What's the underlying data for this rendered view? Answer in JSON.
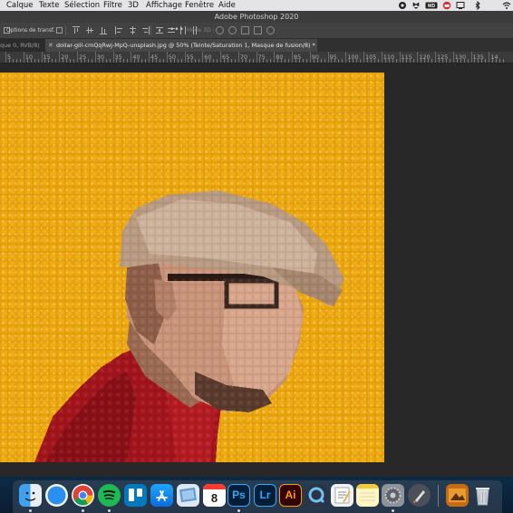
{
  "menubar": {
    "items": [
      "Calque",
      "Texte",
      "Sélection",
      "Filtre",
      "3D",
      "Affichage",
      "Fenêtre",
      "Aide"
    ],
    "status_icons": [
      "record-icon",
      "dropbox-icon",
      "wd-icon",
      "creative-cloud-icon",
      "display-icon",
      "bluetooth-icon",
      "wifi-icon"
    ]
  },
  "titlebar": {
    "title": "Adobe Photoshop 2020"
  },
  "options": {
    "show_transform_label": "Options de transf.",
    "more_label": "•••",
    "mode3d_label": "Mode 3D :"
  },
  "tabs": [
    {
      "label": "que 0, RVB/8)",
      "active": false
    },
    {
      "label": "dollar-gill-cmQqRwj-MpQ-unsplash.jpg @ 50% (Teinte/Saturation 1, Masque de fusion/8) *",
      "active": true
    }
  ],
  "ruler": {
    "labels": [
      "5",
      "10",
      "15",
      "20",
      "25",
      "30",
      "35",
      "40",
      "45",
      "50",
      "55",
      "60",
      "65",
      "70",
      "75",
      "80",
      "85",
      "90",
      "95",
      "100",
      "105",
      "110",
      "115",
      "120",
      "125",
      "130",
      "135",
      "14"
    ]
  },
  "colors": {
    "canvas_bg": "#f1a90a",
    "workspace_bg": "#282828",
    "ps_blue": "#31a8ff",
    "ai_orange": "#ff9a00"
  },
  "canvas": {
    "content": "pixelated-lego-portrait"
  },
  "dock": {
    "apps": [
      {
        "name": "Finder",
        "icon": "finder-icon",
        "text": ""
      },
      {
        "name": "Safari",
        "icon": "safari-icon",
        "text": ""
      },
      {
        "name": "Chrome",
        "icon": "chrome-icon",
        "text": ""
      },
      {
        "name": "Spotify",
        "icon": "spotify-icon",
        "text": ""
      },
      {
        "name": "Trello",
        "icon": "trello-icon",
        "text": ""
      },
      {
        "name": "App Store",
        "icon": "app-store-icon",
        "text": ""
      },
      {
        "name": "Preview",
        "icon": "preview-icon",
        "text": ""
      },
      {
        "name": "Calendar",
        "icon": "calendar-icon",
        "text": "8"
      },
      {
        "name": "Photoshop",
        "icon": "photoshop-icon",
        "text": "Ps"
      },
      {
        "name": "Lightroom",
        "icon": "lightroom-icon",
        "text": "Lr"
      },
      {
        "name": "Illustrator",
        "icon": "illustrator-icon",
        "text": "Ai"
      },
      {
        "name": "QuickTime",
        "icon": "quicktime-icon",
        "text": ""
      },
      {
        "name": "TextEdit",
        "icon": "textedit-icon",
        "text": ""
      },
      {
        "name": "Notes",
        "icon": "notes-icon",
        "text": ""
      },
      {
        "name": "System Preferences",
        "icon": "system-preferences-icon",
        "text": ""
      },
      {
        "name": "Launchpad",
        "icon": "launchpad-icon",
        "text": ""
      },
      {
        "name": "Image Folder",
        "icon": "image-folder-icon",
        "text": ""
      },
      {
        "name": "Trash",
        "icon": "trash-icon",
        "text": ""
      }
    ]
  }
}
